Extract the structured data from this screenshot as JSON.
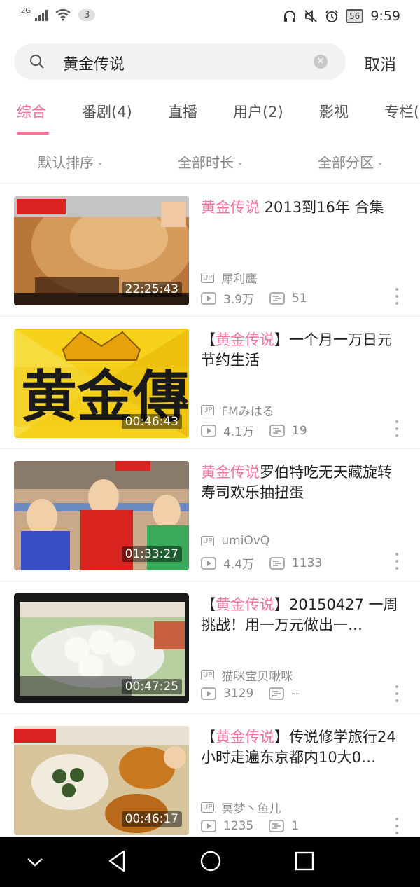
{
  "status_bar": {
    "network": "2G",
    "notification_count": "3",
    "battery": "56",
    "time": "9:59"
  },
  "search": {
    "query": "黄金传说",
    "cancel_label": "取消"
  },
  "tabs": [
    {
      "label": "综合",
      "active": true
    },
    {
      "label": "番剧(4)"
    },
    {
      "label": "直播"
    },
    {
      "label": "用户(2)"
    },
    {
      "label": "影视"
    },
    {
      "label": "专栏("
    }
  ],
  "filters": [
    {
      "label": "默认排序"
    },
    {
      "label": "全部时长"
    },
    {
      "label": "全部分区"
    }
  ],
  "highlight_color": "#fb7299",
  "results": [
    {
      "title_prefix": "",
      "title_keyword": "黄金传说",
      "title_suffix": " 2013到16年 合集",
      "duration": "22:25:43",
      "uploader": "犀利鹰",
      "views": "3.9万",
      "danmaku": "51"
    },
    {
      "title_prefix": "【",
      "title_keyword": "黄金传说",
      "title_suffix": "】一个月一万日元节约生活",
      "duration": "00:46:43",
      "uploader": "FMみはる",
      "views": "4.1万",
      "danmaku": "19"
    },
    {
      "title_prefix": "",
      "title_keyword": "黄金传说",
      "title_suffix": "罗伯特吃无天藏旋转寿司欢乐抽扭蛋",
      "duration": "01:33:27",
      "uploader": "umiOvQ",
      "views": "4.4万",
      "danmaku": "1133"
    },
    {
      "title_prefix": "【",
      "title_keyword": "黄金传说",
      "title_suffix": "】20150427 一周挑战！用一万元做出一…",
      "duration": "00:47:25",
      "uploader": "猫咪宝贝啾咪",
      "views": "3129",
      "danmaku": "--"
    },
    {
      "title_prefix": "【",
      "title_keyword": "黄金传说",
      "title_suffix": "】传说修学旅行24小时走遍东京都内10大0…",
      "duration": "00:46:17",
      "uploader": "冥梦丶鱼儿",
      "views": "1235",
      "danmaku": "1"
    }
  ]
}
